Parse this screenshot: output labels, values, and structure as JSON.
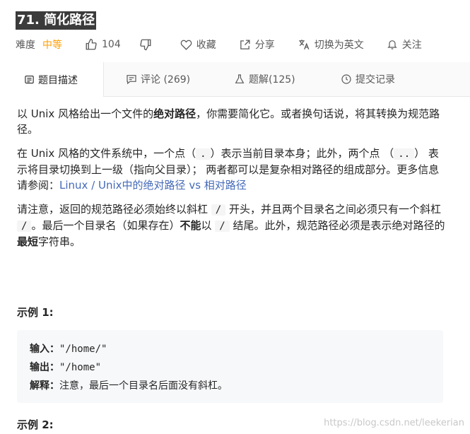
{
  "problem": {
    "title": "71. 简化路径"
  },
  "meta": {
    "difficulty_label": "难度",
    "difficulty_value": "中等",
    "likes": "104",
    "favorite_label": "收藏",
    "share_label": "分享",
    "translate_label": "切换为英文",
    "follow_label": "关注"
  },
  "tabs": [
    {
      "label": "题目描述"
    },
    {
      "label": "评论 (269)"
    },
    {
      "label": "题解(125)"
    },
    {
      "label": "提交记录"
    }
  ],
  "description": {
    "p1_a": "以 Unix 风格给出一个文件的",
    "p1_bold": "绝对路径",
    "p1_b": "，你需要简化它。或者换句话说，将其转换为规范路径。",
    "p2_a": "在 Unix 风格的文件系统中，一个点（",
    "p2_code1": ".",
    "p2_b": "）表示当前目录本身；此外，两个点 （",
    "p2_code2": "..",
    "p2_c": "） 表示将目录切换到上一级（指向父目录）； 两者都可以是复杂相对路径的组成部分。更多信息请参阅：",
    "p2_link": "Linux / Unix中的绝对路径 vs 相对路径",
    "p3_a": "请注意，返回的规范路径必须始终以斜杠 ",
    "p3_code1": "/",
    "p3_b": " 开头，并且两个目录名之间必须只有一个斜杠 ",
    "p3_code2": "/",
    "p3_c": "。最后一个目录名（如果存在）",
    "p3_bold1": "不能",
    "p3_d": "以 ",
    "p3_code3": "/",
    "p3_e": " 结尾。此外，规范路径必须是表示绝对路径的",
    "p3_bold2": "最短",
    "p3_f": "字符串。"
  },
  "example1": {
    "title": "示例 1:",
    "input_label": "输入：",
    "input_value": "\"/home/\"",
    "output_label": "输出：",
    "output_value": "\"/home\"",
    "explain_label": "解释：",
    "explain_value": "注意，最后一个目录名后面没有斜杠。"
  },
  "example2": {
    "title": "示例 2:"
  },
  "watermark": "https://blog.csdn.net/leekerian",
  "colors": {
    "difficulty": "#ff9d00",
    "link": "#456ab8"
  }
}
